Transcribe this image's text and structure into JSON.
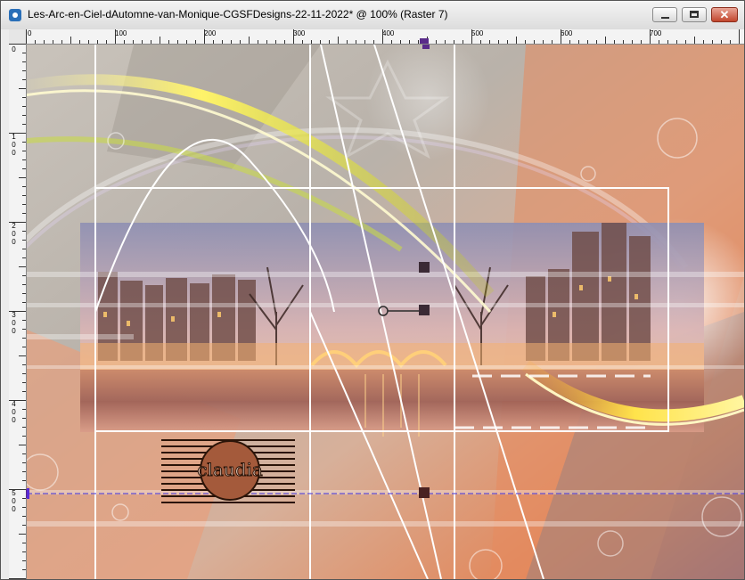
{
  "window": {
    "title": "Les-Arc-en-Ciel-dAutomne-van-Monique-CGSFDesigns-22-11-2022* @ 100% (Raster 7)",
    "minimize_icon": "minimize-icon",
    "maximize_icon": "maximize-icon",
    "close_icon": "close-icon",
    "close_glyph": "✕"
  },
  "ruler_h": {
    "labels": [
      "0",
      "100",
      "200",
      "300",
      "400",
      "500",
      "600",
      "700"
    ]
  },
  "ruler_v": {
    "labels": [
      "0",
      "1\n0\n0",
      "2\n0\n0",
      "3\n0\n0",
      "4\n0\n0",
      "5\n0\n0"
    ]
  },
  "watermark": {
    "text": "claudia"
  },
  "colors": {
    "selection_outline": "#ffffff",
    "handle": "#3b2a35",
    "guide_line": "#3d2bd6"
  }
}
